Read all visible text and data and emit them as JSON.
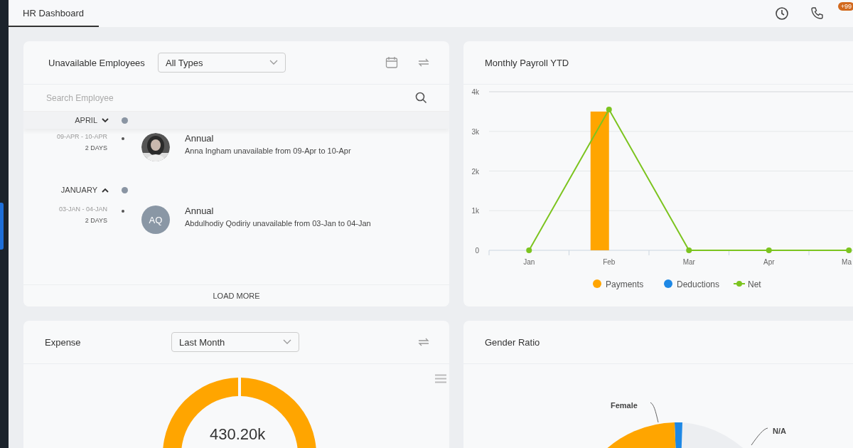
{
  "tabs": [
    {
      "label": "HR Dashboard",
      "selected": true
    }
  ],
  "header": {
    "badge": "+99"
  },
  "unavailable": {
    "title": "Unavailable Employees",
    "filter": "All Types",
    "search": {
      "placeholder": "Search Employee"
    },
    "months": [
      {
        "label": "APRIL",
        "expanded": false,
        "entries": [
          {
            "dates": "09-APR - 10-APR",
            "days": "2 DAYS",
            "type": "Annual",
            "text": "Anna Ingham unavailable from 09-Apr to 10-Apr"
          }
        ]
      },
      {
        "label": "JANUARY",
        "expanded": true,
        "entries": [
          {
            "dates": "03-JAN - 04-JAN",
            "days": "2 DAYS",
            "initials": "AQ",
            "type": "Annual",
            "text": "Abdulhodiy Qodiriy unavailable from 03-Jan to 04-Jan"
          }
        ]
      }
    ],
    "load_more": "LOAD MORE"
  },
  "payroll": {
    "title": "Monthly Payroll YTD",
    "chart_data": {
      "type": "bar",
      "grid": true,
      "legend": "bottom",
      "categories": [
        "Jan",
        "Feb",
        "Mar",
        "Apr",
        "Ma"
      ],
      "ylim": [
        0,
        4000
      ],
      "yticks": [
        {
          "value": 0,
          "label": "0"
        },
        {
          "value": 1000,
          "label": "1k"
        },
        {
          "value": 2000,
          "label": "2k"
        },
        {
          "value": 3000,
          "label": "3k"
        },
        {
          "value": 4000,
          "label": "4k"
        }
      ],
      "series": [
        {
          "name": "Payments",
          "color": "#ffa500",
          "values": [
            0,
            3500,
            0,
            0,
            0
          ]
        },
        {
          "name": "Deductions",
          "color": "#1e88e5",
          "values": [
            0,
            0,
            0,
            0,
            0
          ]
        },
        {
          "name": "Net",
          "color": "#7cc41f",
          "type": "line",
          "marker": "o",
          "values": [
            0,
            3550,
            0,
            0,
            0
          ]
        }
      ]
    }
  },
  "expense": {
    "title": "Expense",
    "filter": "Last Month",
    "total": "430.20k"
  },
  "gender": {
    "title": "Gender Ratio",
    "labels": [
      "Female",
      "N/A"
    ]
  }
}
